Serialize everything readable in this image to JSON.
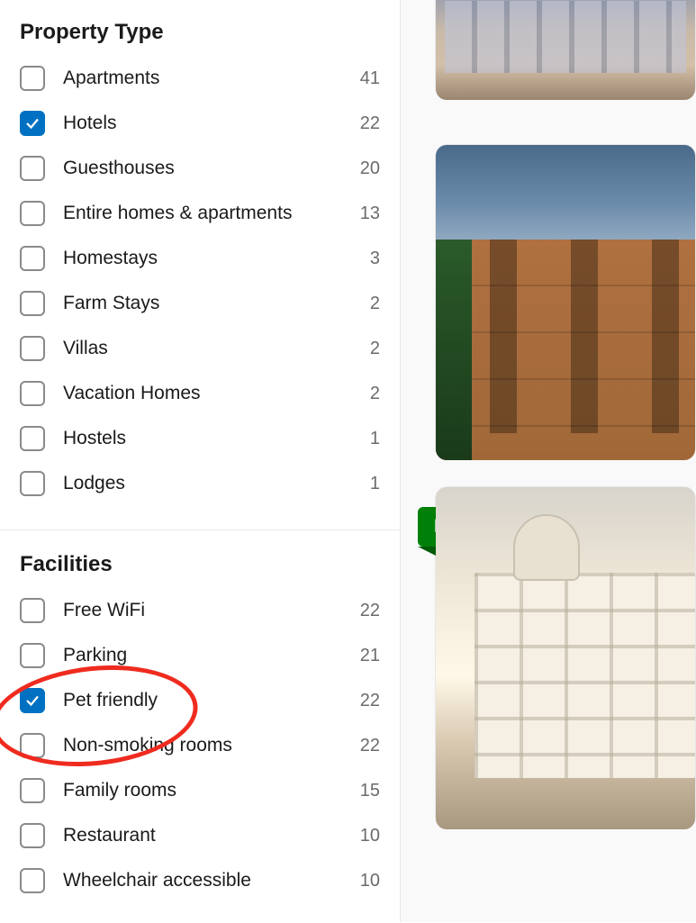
{
  "colors": {
    "accent": "#0071c2",
    "badge": "#008009"
  },
  "sections": {
    "property_type": {
      "title": "Property Type",
      "items": [
        {
          "label": "Apartments",
          "count": 41,
          "checked": false
        },
        {
          "label": "Hotels",
          "count": 22,
          "checked": true
        },
        {
          "label": "Guesthouses",
          "count": 20,
          "checked": false
        },
        {
          "label": "Entire homes & apartments",
          "count": 13,
          "checked": false
        },
        {
          "label": "Homestays",
          "count": 3,
          "checked": false
        },
        {
          "label": "Farm Stays",
          "count": 2,
          "checked": false
        },
        {
          "label": "Villas",
          "count": 2,
          "checked": false
        },
        {
          "label": "Vacation Homes",
          "count": 2,
          "checked": false
        },
        {
          "label": "Hostels",
          "count": 1,
          "checked": false
        },
        {
          "label": "Lodges",
          "count": 1,
          "checked": false
        }
      ]
    },
    "facilities": {
      "title": "Facilities",
      "items": [
        {
          "label": "Free WiFi",
          "count": 22,
          "checked": false
        },
        {
          "label": "Parking",
          "count": 21,
          "checked": false
        },
        {
          "label": "Pet friendly",
          "count": 22,
          "checked": true
        },
        {
          "label": "Non-smoking rooms",
          "count": 22,
          "checked": false
        },
        {
          "label": "Family rooms",
          "count": 15,
          "checked": false
        },
        {
          "label": "Restaurant",
          "count": 10,
          "checked": false
        },
        {
          "label": "Wheelchair accessible",
          "count": 10,
          "checked": false
        }
      ]
    }
  },
  "results": {
    "badge_breakfast": "Breakfast included"
  },
  "annotation": {
    "highlighted_filter": "Pet friendly"
  }
}
